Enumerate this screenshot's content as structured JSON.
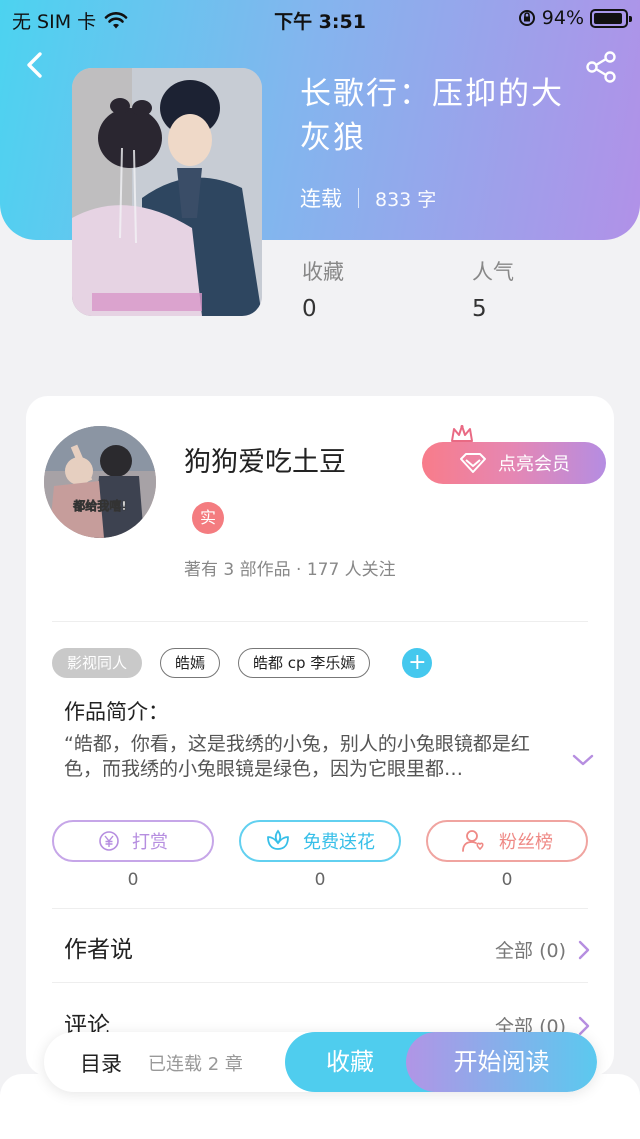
{
  "status_bar": {
    "carrier": "无 SIM 卡",
    "time": "下午 3:51",
    "battery": "94%",
    "battery_level": 0.94
  },
  "book": {
    "title": "长歌行：压抑的大灰狼",
    "status": "连载",
    "word_count": "833 字"
  },
  "stats": [
    {
      "label": "收藏",
      "value": "0"
    },
    {
      "label": "人气",
      "value": "5"
    }
  ],
  "author": {
    "name": "狗狗爱吃土豆",
    "badge": "实",
    "summary": "著有 3 部作品 · 177 人关注",
    "avatar_caption": "都给我嘻!",
    "vip_label": "点亮会员"
  },
  "tags": [
    "影视同人",
    "皓嫣",
    "皓都 cp 李乐嫣"
  ],
  "intro": {
    "label": "作品简介：",
    "text": "“皓都，你看，这是我绣的小兔，别人的小兔眼镜都是红色，而我绣的小兔眼镜是绿色，因为它眼里都…"
  },
  "actions": [
    {
      "label": "打赏",
      "count": "0",
      "icon": "yuan-coin-icon",
      "color": "#b68ee0"
    },
    {
      "label": "免费送花",
      "count": "0",
      "icon": "flower-icon",
      "color": "#45c8ee"
    },
    {
      "label": "粉丝榜",
      "count": "0",
      "icon": "fan-ranking-icon",
      "color": "#ef8a86"
    }
  ],
  "rows": [
    {
      "title": "作者说",
      "more": "全部 (0)"
    },
    {
      "title": "评论",
      "more": "全部 (0)"
    }
  ],
  "bottom_bar": {
    "catalog": "目录",
    "chapters": "已连载 2 章",
    "favorite": "收藏",
    "start_reading": "开始阅读"
  },
  "colors": {
    "header_gradient_start": "#4cd3f0",
    "header_gradient_end": "#b191e8",
    "accent_blue": "#4fcdee",
    "accent_purple": "#b195e6",
    "badge_red": "#f47c80"
  }
}
